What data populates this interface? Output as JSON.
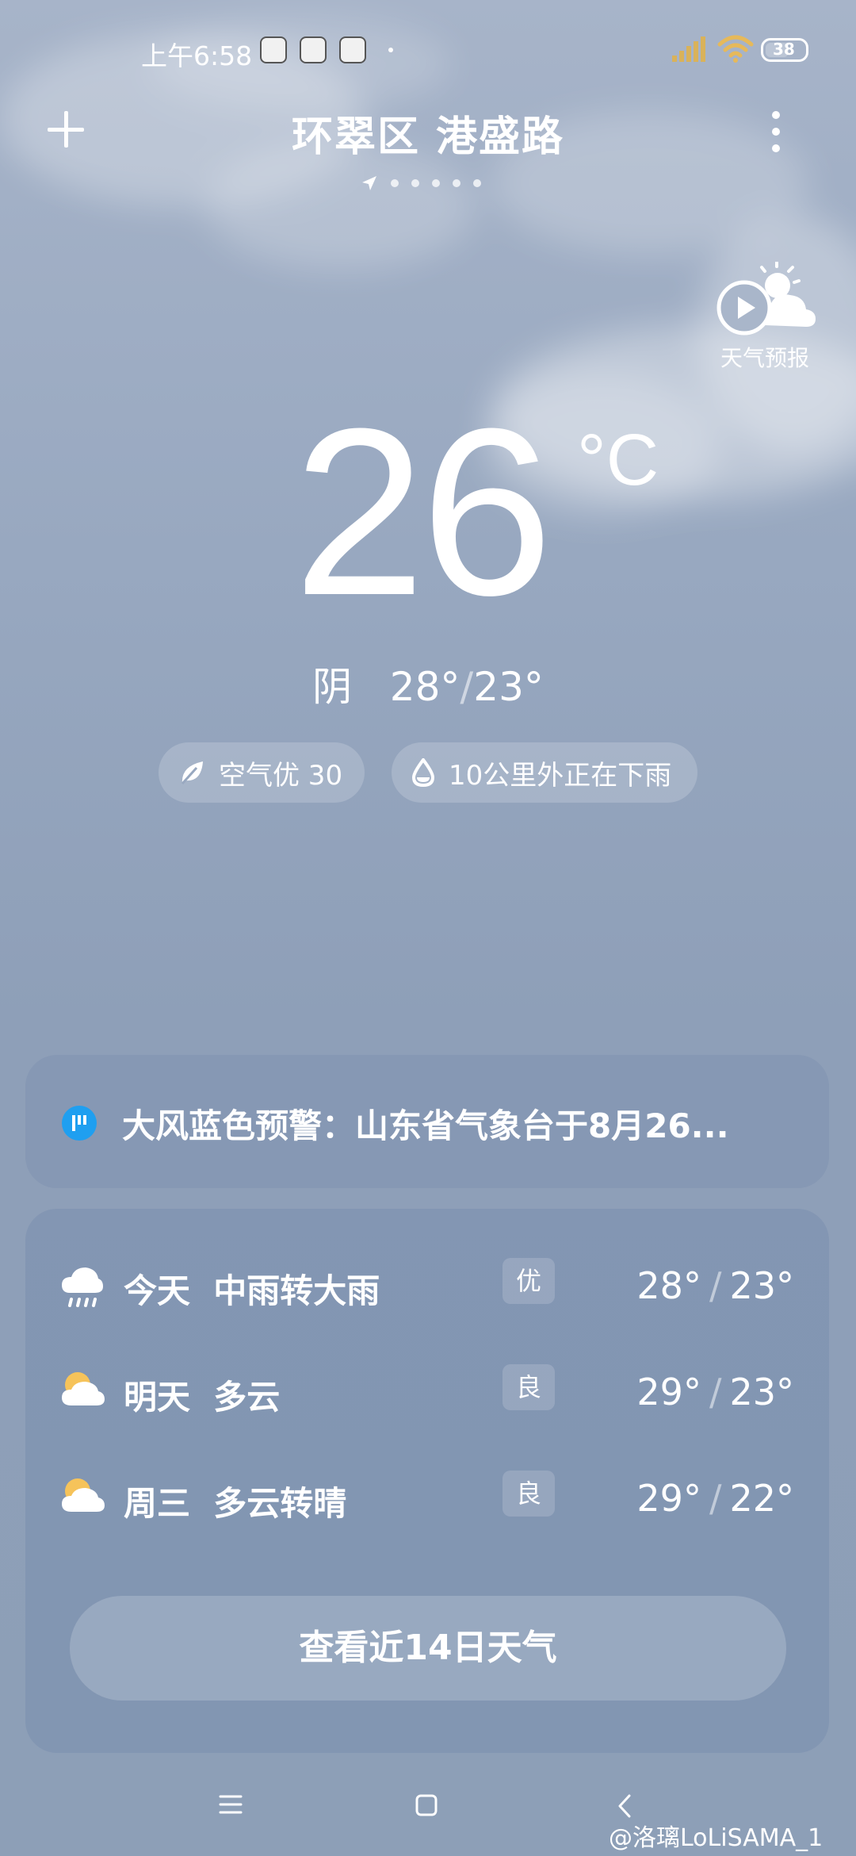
{
  "status_bar": {
    "time": "上午6:58",
    "battery": "38"
  },
  "header": {
    "city": "环翠区 港盛路"
  },
  "video_forecast": {
    "label": "天气预报"
  },
  "current": {
    "temperature": "26",
    "unit": "°C",
    "condition": "阴",
    "high": "28°",
    "low": "23°"
  },
  "chips": {
    "air": "空气优 30",
    "rain": "10公里外正在下雨"
  },
  "alert": {
    "text": "大风蓝色预警：山东省气象台于8月26..."
  },
  "forecast": [
    {
      "day": "今天",
      "desc": "中雨转大雨",
      "aqi": "优",
      "high": "28°",
      "low": "23°",
      "icon": "rain-cloud-icon"
    },
    {
      "day": "明天",
      "desc": "多云",
      "aqi": "良",
      "high": "29°",
      "low": "23°",
      "icon": "partly-cloudy-icon"
    },
    {
      "day": "周三",
      "desc": "多云转晴",
      "aqi": "良",
      "high": "29°",
      "low": "22°",
      "icon": "partly-cloudy-icon"
    }
  ],
  "forecast_button": "查看近14日天气",
  "watermark": "@洛璃LoLiSAMA_1",
  "colors": {
    "alert_icon": "#1f9ff0",
    "sun": "#f6c35a"
  }
}
